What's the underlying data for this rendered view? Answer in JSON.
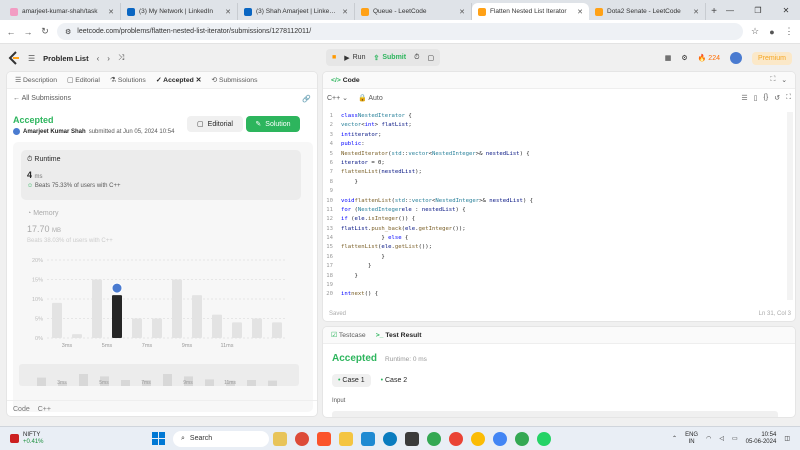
{
  "browser": {
    "tabs": [
      {
        "title": "amarjeet-kumar-shah/task",
        "color": "#f29cc3",
        "active": false
      },
      {
        "title": "(3) My Network | LinkedIn",
        "color": "#0a66c2",
        "active": false
      },
      {
        "title": "(3) Shah Amarjeet | LinkedIn",
        "color": "#0a66c2",
        "active": false
      },
      {
        "title": "Queue - LeetCode",
        "color": "#ffa116",
        "active": false
      },
      {
        "title": "Flatten Nested List Iterator",
        "color": "#ffa116",
        "active": true
      },
      {
        "title": "Dota2 Senate - LeetCode",
        "color": "#ffa116",
        "active": false
      }
    ],
    "url": "leetcode.com/problems/flatten-nested-list-iterator/submissions/1278112011/"
  },
  "topbar": {
    "problem_list": "Problem List",
    "run": "Run",
    "submit": "Submit",
    "streak": "224",
    "premium": "Premium"
  },
  "left": {
    "tabs": [
      "Description",
      "Editorial",
      "Solutions",
      "Accepted",
      "Submissions"
    ],
    "all_submissions": "All Submissions",
    "status": "Accepted",
    "author": "Amarjeet Kumar Shah",
    "submitted_at": "submitted at Jun 05, 2024 10:54",
    "editorial_btn": "Editorial",
    "solution_btn": "Solution",
    "runtime_label": "Runtime",
    "runtime_value": "4",
    "runtime_unit": "ms",
    "runtime_beats": "Beats 75.33% of users with C++",
    "memory_label": "Memory",
    "memory_value": "17.70",
    "memory_unit": "MB",
    "memory_beats": "Beats 38.03% of users with C++",
    "y_ticks": [
      "20%",
      "15%",
      "10%",
      "5%",
      "0%"
    ],
    "x_ticks": [
      "3ms",
      "5ms",
      "7ms",
      "9ms",
      "11ms"
    ],
    "runtime_hist": [
      9,
      1,
      15,
      11,
      5,
      5,
      15,
      11,
      6,
      4,
      5,
      4
    ],
    "user_bar_index": 3,
    "mini_ticks": [
      "3ms",
      "5ms",
      "7ms",
      "9ms",
      "11ms"
    ],
    "footer": [
      "Code",
      "C++"
    ]
  },
  "code": {
    "title": "Code",
    "lang": "C++",
    "auto": "Auto",
    "saved": "Saved",
    "position": "Ln 31, Col 3"
  },
  "test": {
    "tabs": [
      "Testcase",
      "Test Result"
    ],
    "status": "Accepted",
    "runtime": "Runtime: 0 ms",
    "cases": [
      "Case 1",
      "Case 2"
    ],
    "input_label": "Input"
  },
  "taskbar": {
    "ticker": "NIFTY",
    "change": "+0.41%",
    "search": "Search",
    "lang": "ENG",
    "region": "IN",
    "time": "10:54",
    "date": "05-06-2024"
  }
}
